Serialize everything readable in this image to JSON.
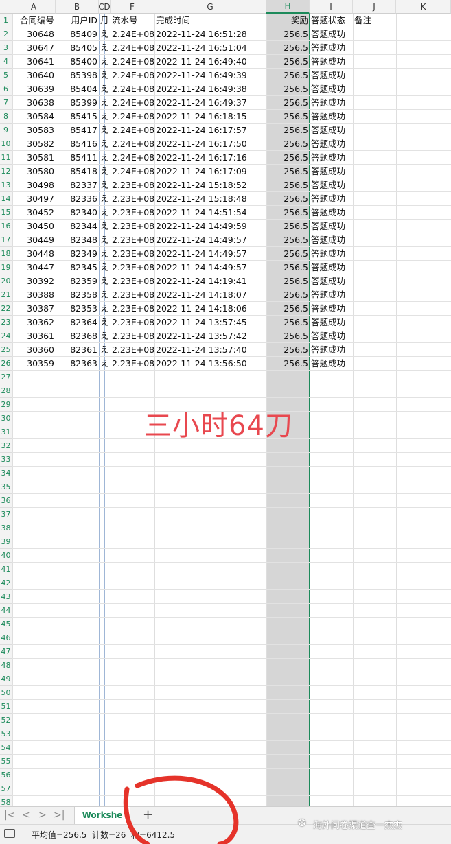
{
  "columns": [
    "A",
    "B",
    "C",
    "D",
    "E",
    "F",
    "G",
    "H",
    "I",
    "J",
    "K"
  ],
  "header_row": {
    "A": "合同编号",
    "B": "用户ID",
    "E": "月",
    "F": "流水号",
    "G": "完成时间",
    "H": "奖励",
    "I": "答题状态",
    "J": "备注"
  },
  "rows": [
    {
      "A": "30648",
      "B": "85409",
      "F": "2.24E+08",
      "G": "2022-11-24 16:51:28",
      "H": "256.5",
      "I": "答题成功"
    },
    {
      "A": "30647",
      "B": "85405",
      "F": "2.24E+08",
      "G": "2022-11-24 16:51:04",
      "H": "256.5",
      "I": "答题成功"
    },
    {
      "A": "30641",
      "B": "85400",
      "F": "2.24E+08",
      "G": "2022-11-24 16:49:40",
      "H": "256.5",
      "I": "答题成功"
    },
    {
      "A": "30640",
      "B": "85398",
      "F": "2.24E+08",
      "G": "2022-11-24 16:49:39",
      "H": "256.5",
      "I": "答题成功"
    },
    {
      "A": "30639",
      "B": "85404",
      "F": "2.24E+08",
      "G": "2022-11-24 16:49:38",
      "H": "256.5",
      "I": "答题成功"
    },
    {
      "A": "30638",
      "B": "85399",
      "F": "2.24E+08",
      "G": "2022-11-24 16:49:37",
      "H": "256.5",
      "I": "答题成功"
    },
    {
      "A": "30584",
      "B": "85415",
      "F": "2.24E+08",
      "G": "2022-11-24 16:18:15",
      "H": "256.5",
      "I": "答题成功"
    },
    {
      "A": "30583",
      "B": "85417",
      "F": "2.24E+08",
      "G": "2022-11-24 16:17:57",
      "H": "256.5",
      "I": "答题成功"
    },
    {
      "A": "30582",
      "B": "85416",
      "F": "2.24E+08",
      "G": "2022-11-24 16:17:50",
      "H": "256.5",
      "I": "答题成功"
    },
    {
      "A": "30581",
      "B": "85411",
      "F": "2.24E+08",
      "G": "2022-11-24 16:17:16",
      "H": "256.5",
      "I": "答题成功"
    },
    {
      "A": "30580",
      "B": "85418",
      "F": "2.24E+08",
      "G": "2022-11-24 16:17:09",
      "H": "256.5",
      "I": "答题成功"
    },
    {
      "A": "30498",
      "B": "82337",
      "F": "2.23E+08",
      "G": "2022-11-24 15:18:52",
      "H": "256.5",
      "I": "答题成功"
    },
    {
      "A": "30497",
      "B": "82336",
      "F": "2.23E+08",
      "G": "2022-11-24 15:18:48",
      "H": "256.5",
      "I": "答题成功"
    },
    {
      "A": "30452",
      "B": "82340",
      "F": "2.23E+08",
      "G": "2022-11-24 14:51:54",
      "H": "256.5",
      "I": "答题成功"
    },
    {
      "A": "30450",
      "B": "82344",
      "F": "2.23E+08",
      "G": "2022-11-24 14:49:59",
      "H": "256.5",
      "I": "答题成功"
    },
    {
      "A": "30449",
      "B": "82348",
      "F": "2.23E+08",
      "G": "2022-11-24 14:49:57",
      "H": "256.5",
      "I": "答题成功"
    },
    {
      "A": "30448",
      "B": "82349",
      "F": "2.23E+08",
      "G": "2022-11-24 14:49:57",
      "H": "256.5",
      "I": "答题成功"
    },
    {
      "A": "30447",
      "B": "82345",
      "F": "2.23E+08",
      "G": "2022-11-24 14:49:57",
      "H": "256.5",
      "I": "答题成功"
    },
    {
      "A": "30392",
      "B": "82359",
      "F": "2.23E+08",
      "G": "2022-11-24 14:19:41",
      "H": "256.5",
      "I": "答题成功"
    },
    {
      "A": "30388",
      "B": "82358",
      "F": "2.23E+08",
      "G": "2022-11-24 14:18:07",
      "H": "256.5",
      "I": "答题成功"
    },
    {
      "A": "30387",
      "B": "82353",
      "F": "2.23E+08",
      "G": "2022-11-24 14:18:06",
      "H": "256.5",
      "I": "答题成功"
    },
    {
      "A": "30362",
      "B": "82364",
      "F": "2.23E+08",
      "G": "2022-11-24 13:57:45",
      "H": "256.5",
      "I": "答题成功"
    },
    {
      "A": "30361",
      "B": "82368",
      "F": "2.23E+08",
      "G": "2022-11-24 13:57:42",
      "H": "256.5",
      "I": "答题成功"
    },
    {
      "A": "30360",
      "B": "82361",
      "F": "2.23E+08",
      "G": "2022-11-24 13:57:40",
      "H": "256.5",
      "I": "答题成功"
    },
    {
      "A": "30359",
      "B": "82363",
      "F": "2.23E+08",
      "G": "2022-11-24 13:56:50",
      "H": "256.5",
      "I": "答题成功"
    }
  ],
  "cut_off_glyph": "え",
  "selected_column": "H",
  "overlay_text": "三小时64刀",
  "sheet_tab": "Workshe",
  "add_sheet": "+",
  "nav_buttons": [
    "|<",
    "<",
    ">",
    ">|"
  ],
  "status": {
    "average": "平均值=256.5",
    "count": "计数=26",
    "sum": "和=6412.5"
  },
  "watermark": "海外问卷渠道查一杰杰",
  "colors": {
    "accent": "#1c8a5a",
    "annotation": "#e8484f",
    "selection_fill": "#d6d6d6"
  }
}
